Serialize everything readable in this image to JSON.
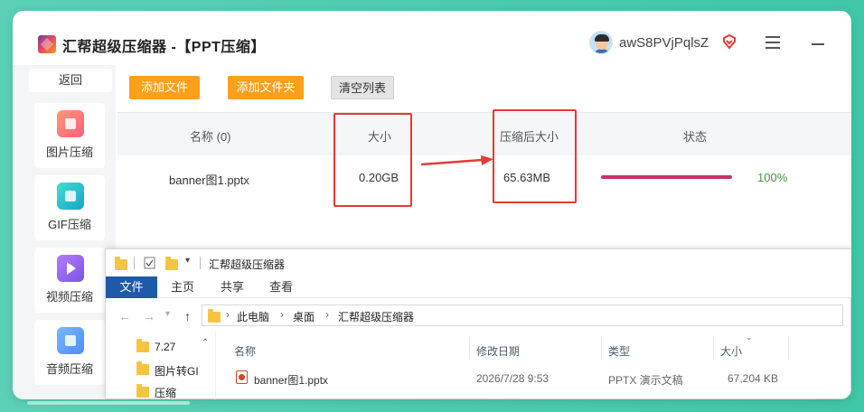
{
  "app": {
    "title": "汇帮超级压缩器  -【PPT压缩】",
    "username": "awS8PVjPqlsZ"
  },
  "sidebar": {
    "back_label": "返回",
    "items": [
      {
        "label": "图片压缩",
        "icon": "image-compress-icon"
      },
      {
        "label": "GIF压缩",
        "icon": "gif-compress-icon"
      },
      {
        "label": "视频压缩",
        "icon": "video-compress-icon"
      },
      {
        "label": "音频压缩",
        "icon": "audio-compress-icon"
      }
    ]
  },
  "toolbar": {
    "add_file": "添加文件",
    "add_folder": "添加文件夹",
    "clear_list": "清空列表"
  },
  "table": {
    "headers": {
      "name": "名称 (0)",
      "size": "大小",
      "compressed_size": "压缩后大小",
      "status": "状态"
    },
    "rows": [
      {
        "name": "banner图1.pptx",
        "size": "0.20GB",
        "compressed_size": "65.63MB",
        "progress": 1.0,
        "progress_text": "100%"
      }
    ]
  },
  "explorer": {
    "title": "汇帮超级压缩器",
    "ribbon": {
      "file": "文件",
      "home": "主页",
      "share": "共享",
      "view": "查看"
    },
    "address": {
      "part1": "此电脑",
      "part2": "桌面",
      "part3": "汇帮超级压缩器"
    },
    "tree": [
      "7.27",
      "图片转GI",
      "压缩"
    ],
    "columns": {
      "name": "名称",
      "modified": "修改日期",
      "type": "类型",
      "size": "大小"
    },
    "files": [
      {
        "name": "banner图1.pptx",
        "modified": "2026/7/28 9:53",
        "type": "PPTX 演示文稿",
        "size": "67,204 KB"
      }
    ]
  },
  "colors": {
    "accent_orange": "#ff9f1a",
    "highlight_red": "#e53935",
    "progress": "#c8306b",
    "status_green": "#3a9a3a",
    "explorer_blue": "#1e5aa8"
  }
}
